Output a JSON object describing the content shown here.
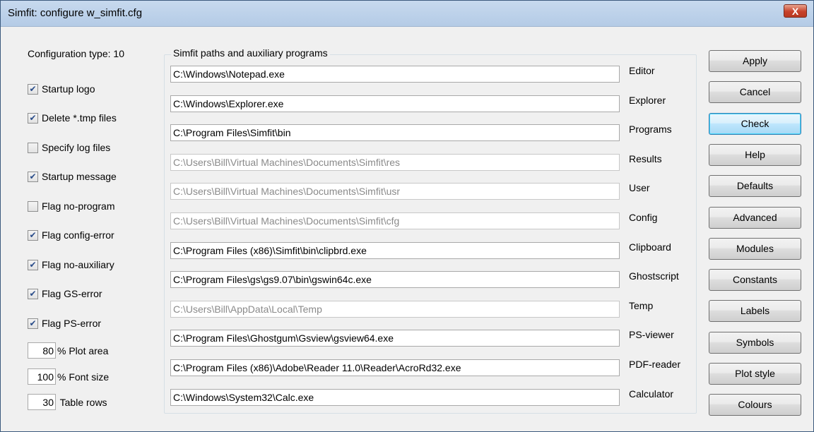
{
  "window": {
    "title": "Simfit: configure w_simfit.cfg",
    "close_label": "X"
  },
  "left": {
    "config_type": "Configuration type: 10",
    "checkboxes": [
      {
        "label": "Startup logo",
        "checked": true
      },
      {
        "label": "Delete *.tmp files",
        "checked": true
      },
      {
        "label": "Specify log files",
        "checked": false
      },
      {
        "label": "Startup message",
        "checked": true
      },
      {
        "label": "Flag no-program",
        "checked": false
      },
      {
        "label": "Flag config-error",
        "checked": true
      },
      {
        "label": "Flag no-auxiliary",
        "checked": true
      },
      {
        "label": "Flag GS-error",
        "checked": true
      },
      {
        "label": "Flag PS-error",
        "checked": true
      }
    ],
    "numbers": [
      {
        "value": "80",
        "label": "% Plot area"
      },
      {
        "value": "100",
        "label": "% Font size"
      },
      {
        "value": "30",
        "label": " Table rows"
      }
    ]
  },
  "group": {
    "legend": "Simfit paths and auxiliary programs",
    "rows": [
      {
        "path": "C:\\Windows\\Notepad.exe",
        "label": "Editor",
        "disabled": false
      },
      {
        "path": "C:\\Windows\\Explorer.exe",
        "label": "Explorer",
        "disabled": false
      },
      {
        "path": "C:\\Program Files\\Simfit\\bin",
        "label": "Programs",
        "disabled": false
      },
      {
        "path": "C:\\Users\\Bill\\Virtual Machines\\Documents\\Simfit\\res",
        "label": "Results",
        "disabled": true
      },
      {
        "path": "C:\\Users\\Bill\\Virtual Machines\\Documents\\Simfit\\usr",
        "label": "User",
        "disabled": true
      },
      {
        "path": "C:\\Users\\Bill\\Virtual Machines\\Documents\\Simfit\\cfg",
        "label": "Config",
        "disabled": true
      },
      {
        "path": "C:\\Program Files (x86)\\Simfit\\bin\\clipbrd.exe",
        "label": "Clipboard",
        "disabled": false
      },
      {
        "path": "C:\\Program Files\\gs\\gs9.07\\bin\\gswin64c.exe",
        "label": "Ghostscript",
        "disabled": false
      },
      {
        "path": "C:\\Users\\Bill\\AppData\\Local\\Temp",
        "label": "Temp",
        "disabled": true
      },
      {
        "path": "C:\\Program Files\\Ghostgum\\Gsview\\gsview64.exe",
        "label": "PS-viewer",
        "disabled": false
      },
      {
        "path": "C:\\Program Files (x86)\\Adobe\\Reader 11.0\\Reader\\AcroRd32.exe",
        "label": "PDF-reader",
        "disabled": false
      },
      {
        "path": "C:\\Windows\\System32\\Calc.exe",
        "label": "Calculator",
        "disabled": false
      }
    ]
  },
  "buttons": [
    "Apply",
    "Cancel",
    "Check",
    "Help",
    "Defaults",
    "Advanced",
    "Modules",
    "Constants",
    "Labels",
    "Symbols",
    "Plot style",
    "Colours"
  ]
}
